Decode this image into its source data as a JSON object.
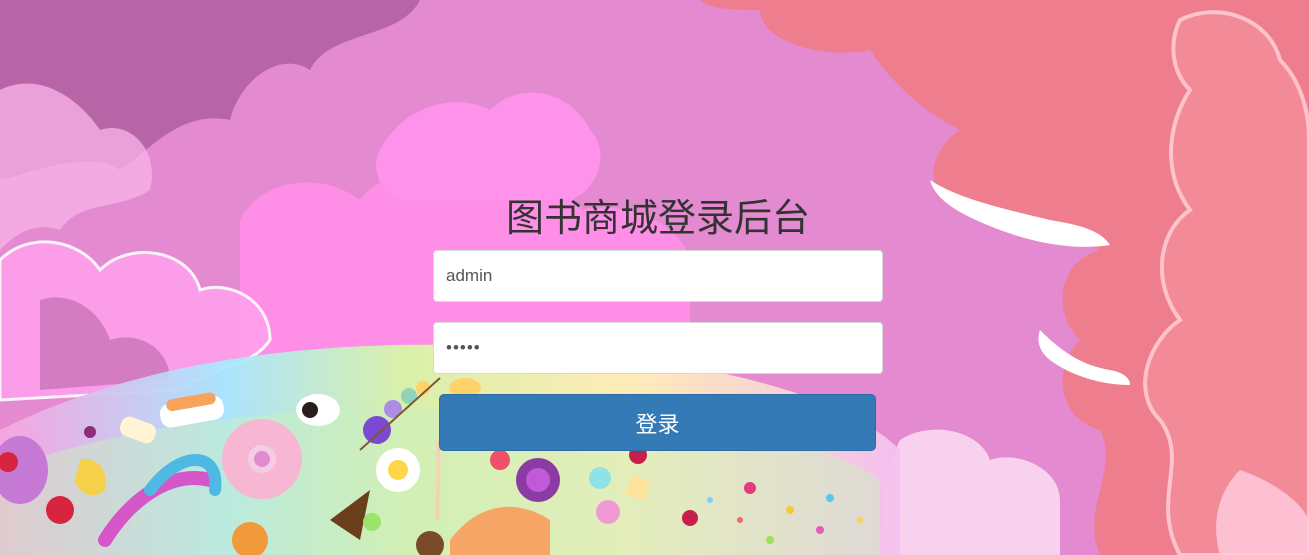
{
  "login": {
    "title": "图书商城登录后台",
    "username_value": "admin",
    "password_value": "admin",
    "submit_label": "登录"
  },
  "colors": {
    "sky_pink": "#e38ad0",
    "cloud_magenta": "#b865a8",
    "cloud_coral": "#ee7e8d",
    "button_blue": "#337ab7",
    "title_text": "#333333"
  }
}
